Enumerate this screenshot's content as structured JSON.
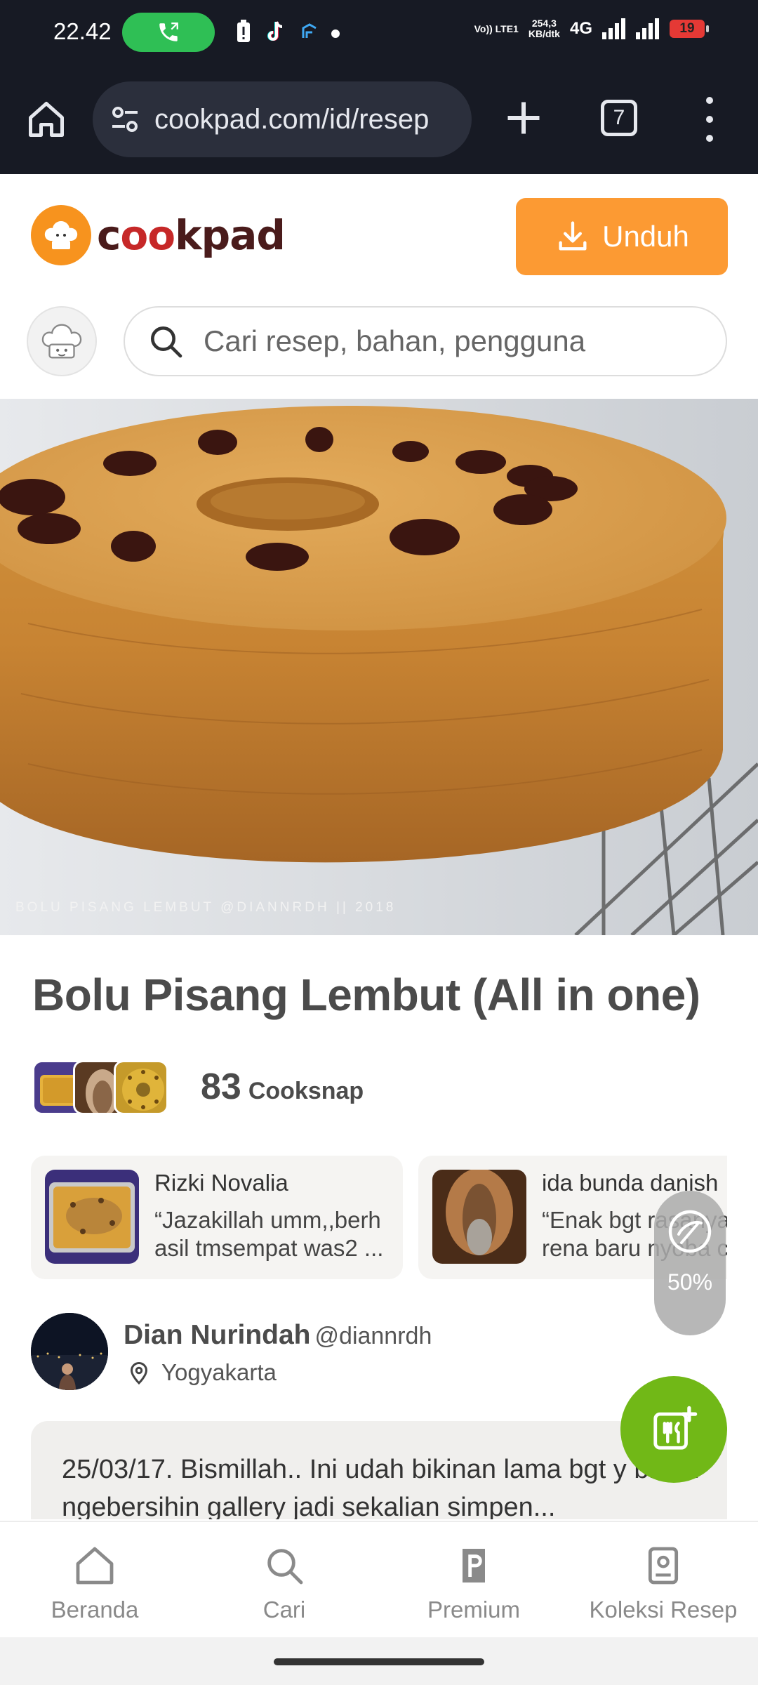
{
  "status_bar": {
    "time": "22.42",
    "net_lte": "Vo)) LTE1",
    "net_speed_value": "254,3",
    "net_speed_unit": "KB/dtk",
    "network_type": "4G",
    "battery": "19"
  },
  "browser": {
    "url": "cookpad.com/id/resep",
    "tab_count": "7"
  },
  "header": {
    "logo_text": "cookpad",
    "download_label": "Unduh"
  },
  "search": {
    "placeholder": "Cari resep, bahan, pengguna"
  },
  "hero": {
    "caption": "BOLU PISANG LEMBUT @DIANNRDH || 2018"
  },
  "recipe": {
    "title": "Bolu Pisang Lembut (All in one)",
    "cooksnap_count": "83",
    "cooksnap_label": "Cooksnap"
  },
  "cooksnaps": [
    {
      "name": "Rizki Novalia",
      "quote": "“Jazakillah umm,,berh\nasil tmsempat was2 ..."
    },
    {
      "name": "ida bunda danish",
      "quote": "“Enak bgt rasanya\nrena baru nyoba c"
    }
  ],
  "zoom": {
    "label": "50%"
  },
  "author": {
    "name": "Dian Nurindah",
    "handle": "@diannrdh",
    "location": "Yogyakarta"
  },
  "story": {
    "text": "25/03/17. Bismillah.. Ini udah bikinan lama bgt y biasa ngebersihin gallery jadi sekalian simpen..."
  },
  "bottom_nav": [
    {
      "label": "Beranda",
      "icon": "home-icon"
    },
    {
      "label": "Cari",
      "icon": "search-icon"
    },
    {
      "label": "Premium",
      "icon": "premium-icon"
    },
    {
      "label": "Koleksi Resep",
      "icon": "collection-icon"
    }
  ],
  "colors": {
    "brand_orange": "#fc9a33",
    "fab_green": "#71b817",
    "status_bg": "#171a24"
  }
}
